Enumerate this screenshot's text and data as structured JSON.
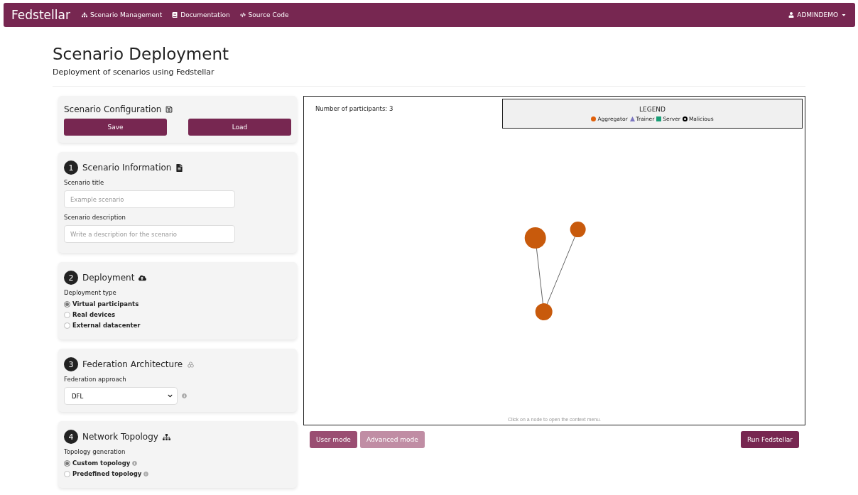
{
  "navbar": {
    "brand": "Fedstellar",
    "links": [
      {
        "label": "Scenario Management"
      },
      {
        "label": "Documentation"
      },
      {
        "label": "Source Code"
      }
    ],
    "user": "ADMINDEMO"
  },
  "header": {
    "title": "Scenario Deployment",
    "subtitle": "Deployment of scenarios using Fedstellar"
  },
  "config": {
    "title": "Scenario Configuration",
    "buttons": [
      "Save",
      "Load"
    ]
  },
  "sections": [
    {
      "number": "1",
      "title": "Scenario Information",
      "fields": [
        {
          "kind": "text",
          "label": "Scenario title",
          "placeholder": "Example scenario"
        },
        {
          "kind": "text",
          "label": "Scenario description",
          "placeholder": "Write a description for the scenario"
        }
      ]
    },
    {
      "number": "2",
      "title": "Deployment",
      "fields": [
        {
          "kind": "radio",
          "label": "Deployment type",
          "options": [
            {
              "label": "Virtual participants",
              "selected": true
            },
            {
              "label": "Real devices",
              "selected": false
            },
            {
              "label": "External datacenter",
              "selected": false
            }
          ]
        }
      ]
    },
    {
      "number": "3",
      "title": "Federation Architecture",
      "fields": [
        {
          "kind": "select",
          "label": "Federation approach",
          "value": "DFL",
          "info": true
        }
      ]
    },
    {
      "number": "4",
      "title": "Network Topology",
      "fields": [
        {
          "kind": "radio",
          "label": "Topology generation",
          "options": [
            {
              "label": "Custom topology",
              "selected": true,
              "info": true
            },
            {
              "label": "Predefined topology",
              "selected": false,
              "info": true
            }
          ]
        }
      ]
    }
  ],
  "graph": {
    "participants": "Number of participants: 3",
    "legend": {
      "title": "LEGEND",
      "items": [
        {
          "label": "Aggregator",
          "kind": "circle",
          "color": "#e0600b"
        },
        {
          "label": "Trainer",
          "kind": "triangle",
          "color": "#7b76c0"
        },
        {
          "label": "Server",
          "kind": "square",
          "color": "#1a9e77"
        },
        {
          "label": "Malicious",
          "kind": "ring",
          "color": "#000000"
        }
      ]
    },
    "nodes": [
      {
        "kind": "aggregator"
      },
      {
        "kind": "aggregator"
      },
      {
        "kind": "aggregator"
      }
    ],
    "hint": "Click on a node to open the context menu."
  },
  "modes": [
    {
      "label": "User mode",
      "selected": true
    },
    {
      "label": "Advanced mode",
      "selected": false
    }
  ],
  "run_button": "Run Fedstellar"
}
